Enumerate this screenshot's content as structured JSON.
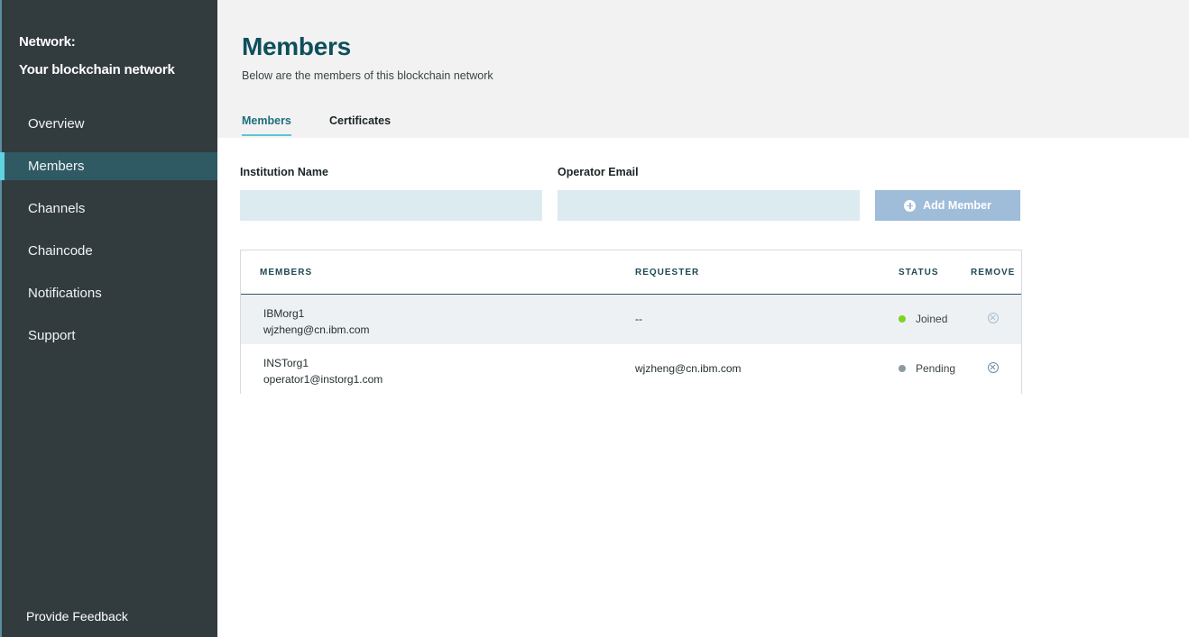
{
  "sidebar": {
    "network_label": "Network:",
    "network_name": "Your blockchain network",
    "items": [
      {
        "label": "Overview"
      },
      {
        "label": "Members"
      },
      {
        "label": "Channels"
      },
      {
        "label": "Chaincode"
      },
      {
        "label": "Notifications"
      },
      {
        "label": "Support"
      }
    ],
    "active_item": "Members",
    "feedback_label": "Provide Feedback"
  },
  "header": {
    "title": "Members",
    "subtitle": "Below are the members of this blockchain network",
    "tabs": [
      {
        "label": "Members",
        "active": true
      },
      {
        "label": "Certificates",
        "active": false
      }
    ]
  },
  "form": {
    "institution_label": "Institution Name",
    "institution_value": "",
    "email_label": "Operator Email",
    "email_value": "",
    "add_button_label": "Add Member",
    "add_button_icon": "plus-circle-icon"
  },
  "table": {
    "columns": [
      "MEMBERS",
      "REQUESTER",
      "STATUS",
      "REMOVE"
    ],
    "rows": [
      {
        "name": "IBMorg1",
        "email": "wjzheng@cn.ibm.com",
        "requester": "--",
        "status": "Joined",
        "status_color": "#7ed321"
      },
      {
        "name": "INSTorg1",
        "email": "operator1@instorg1.com",
        "requester": "wjzheng@cn.ibm.com",
        "status": "Pending",
        "status_color": "#8c9aa3"
      }
    ]
  },
  "colors": {
    "sidebar_bg": "#323b3d",
    "accent": "#5fd3e0",
    "title": "#0e4f5b",
    "button": "#9fbcd9"
  }
}
